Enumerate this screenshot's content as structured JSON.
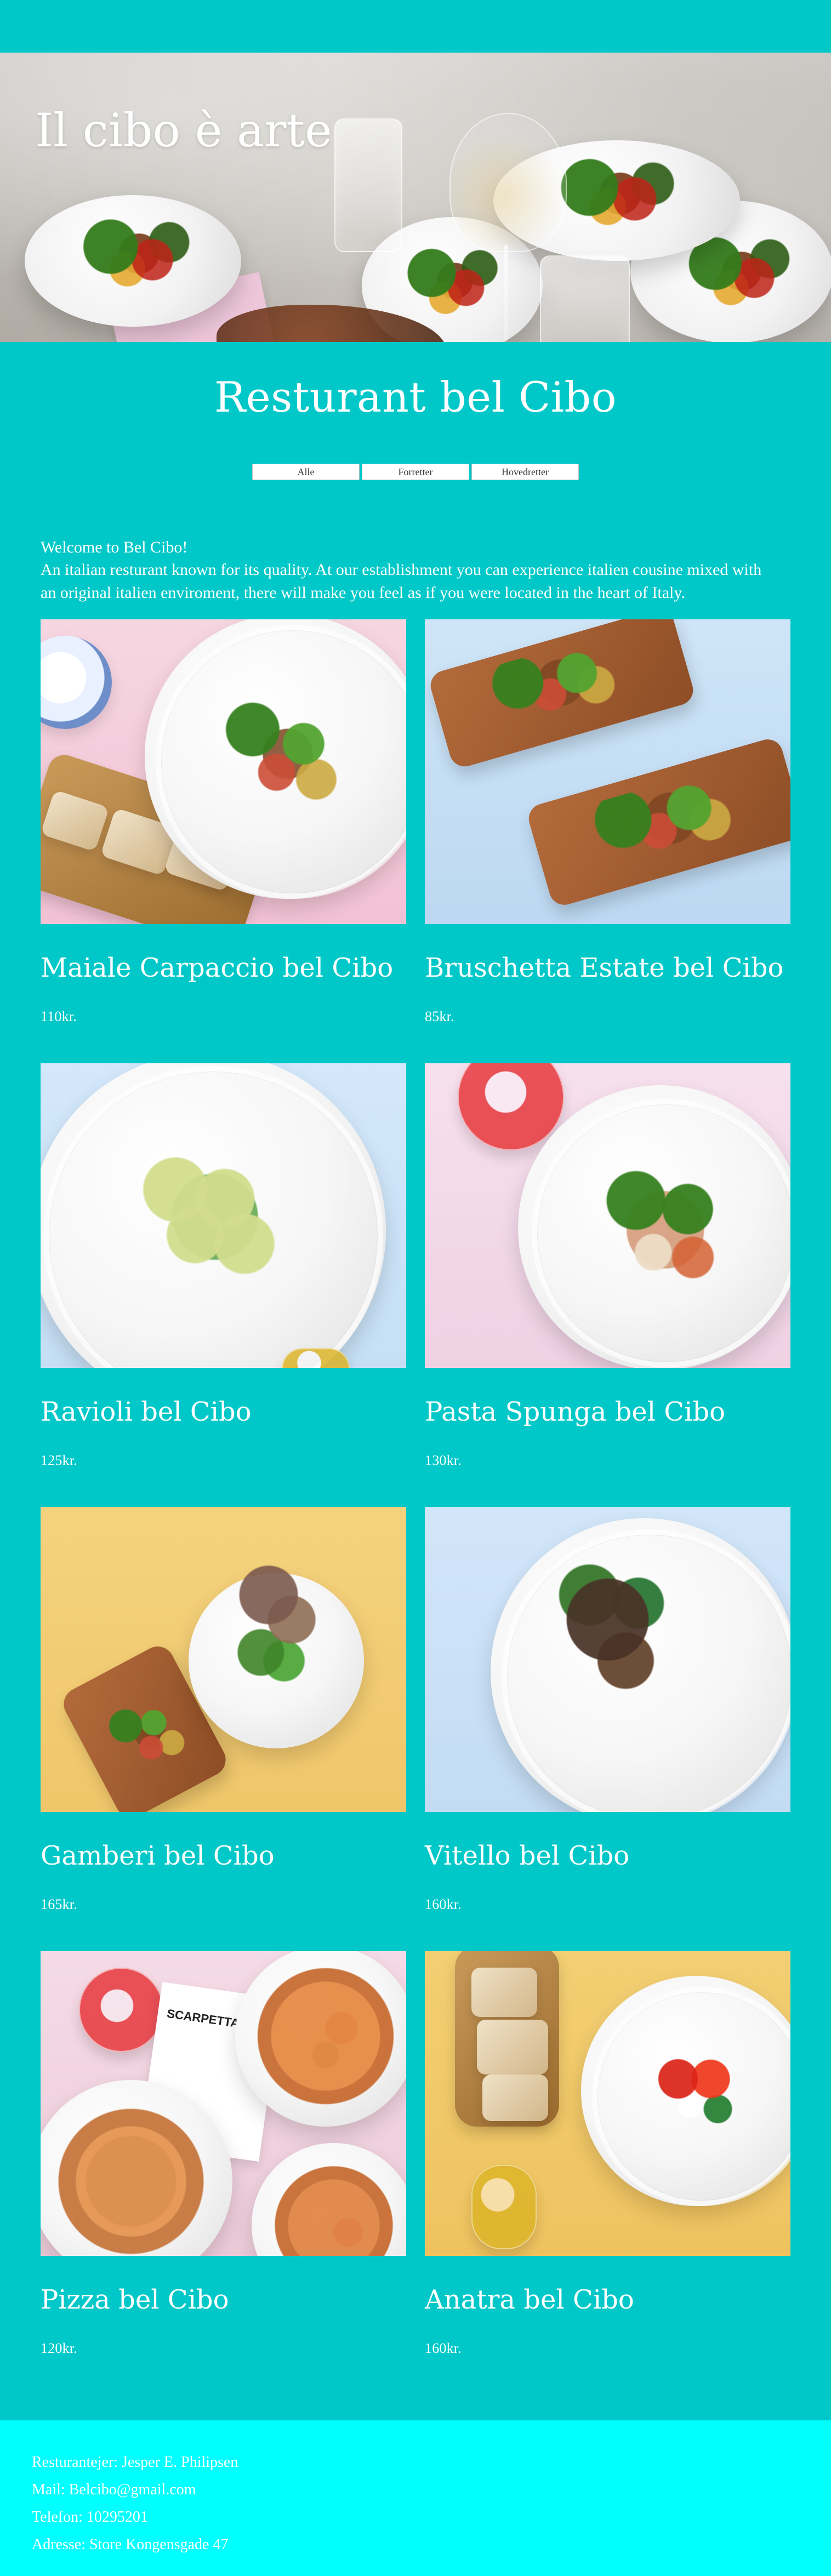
{
  "hero": {
    "title": "Il cibo è arte"
  },
  "main": {
    "title": "Resturant bel Cibo"
  },
  "filters": {
    "labels": [
      "Alle",
      "Forretter",
      "Hovedretter"
    ]
  },
  "welcome": {
    "line1": "Welcome to Bel Cibo!",
    "line2": "An italian resturant known for its quality. At our establishment you can experience italien cousine mixed with an original italien enviroment, there will make you feel as if you were located in the heart of Italy."
  },
  "menu": {
    "items": [
      {
        "name": "Maiale Carpaccio bel Cibo",
        "price": "110kr."
      },
      {
        "name": "Bruschetta Estate bel Cibo",
        "price": "85kr."
      },
      {
        "name": "Ravioli bel Cibo",
        "price": "125kr."
      },
      {
        "name": "Pasta Spunga bel Cibo",
        "price": "130kr."
      },
      {
        "name": "Gamberi bel Cibo",
        "price": "165kr."
      },
      {
        "name": "Vitello bel Cibo",
        "price": "160kr."
      },
      {
        "name": "Pizza bel Cibo",
        "price": "120kr."
      },
      {
        "name": "Anatra bel Cibo",
        "price": "160kr."
      }
    ],
    "menu_word": "SCARPETTA"
  },
  "footer": {
    "owner": "Resturantejer: Jesper E. Philipsen",
    "mail": "Mail: Belcibo@gmail.com",
    "phone": "Telefon: 10295201",
    "address": "Adresse: Store Kongensgade 47"
  },
  "colors": {
    "page_bg": "#00C8C8",
    "footer_bg": "#00FFFF",
    "button_bg": "#FFFFFF",
    "text": "#FFFFFF"
  }
}
